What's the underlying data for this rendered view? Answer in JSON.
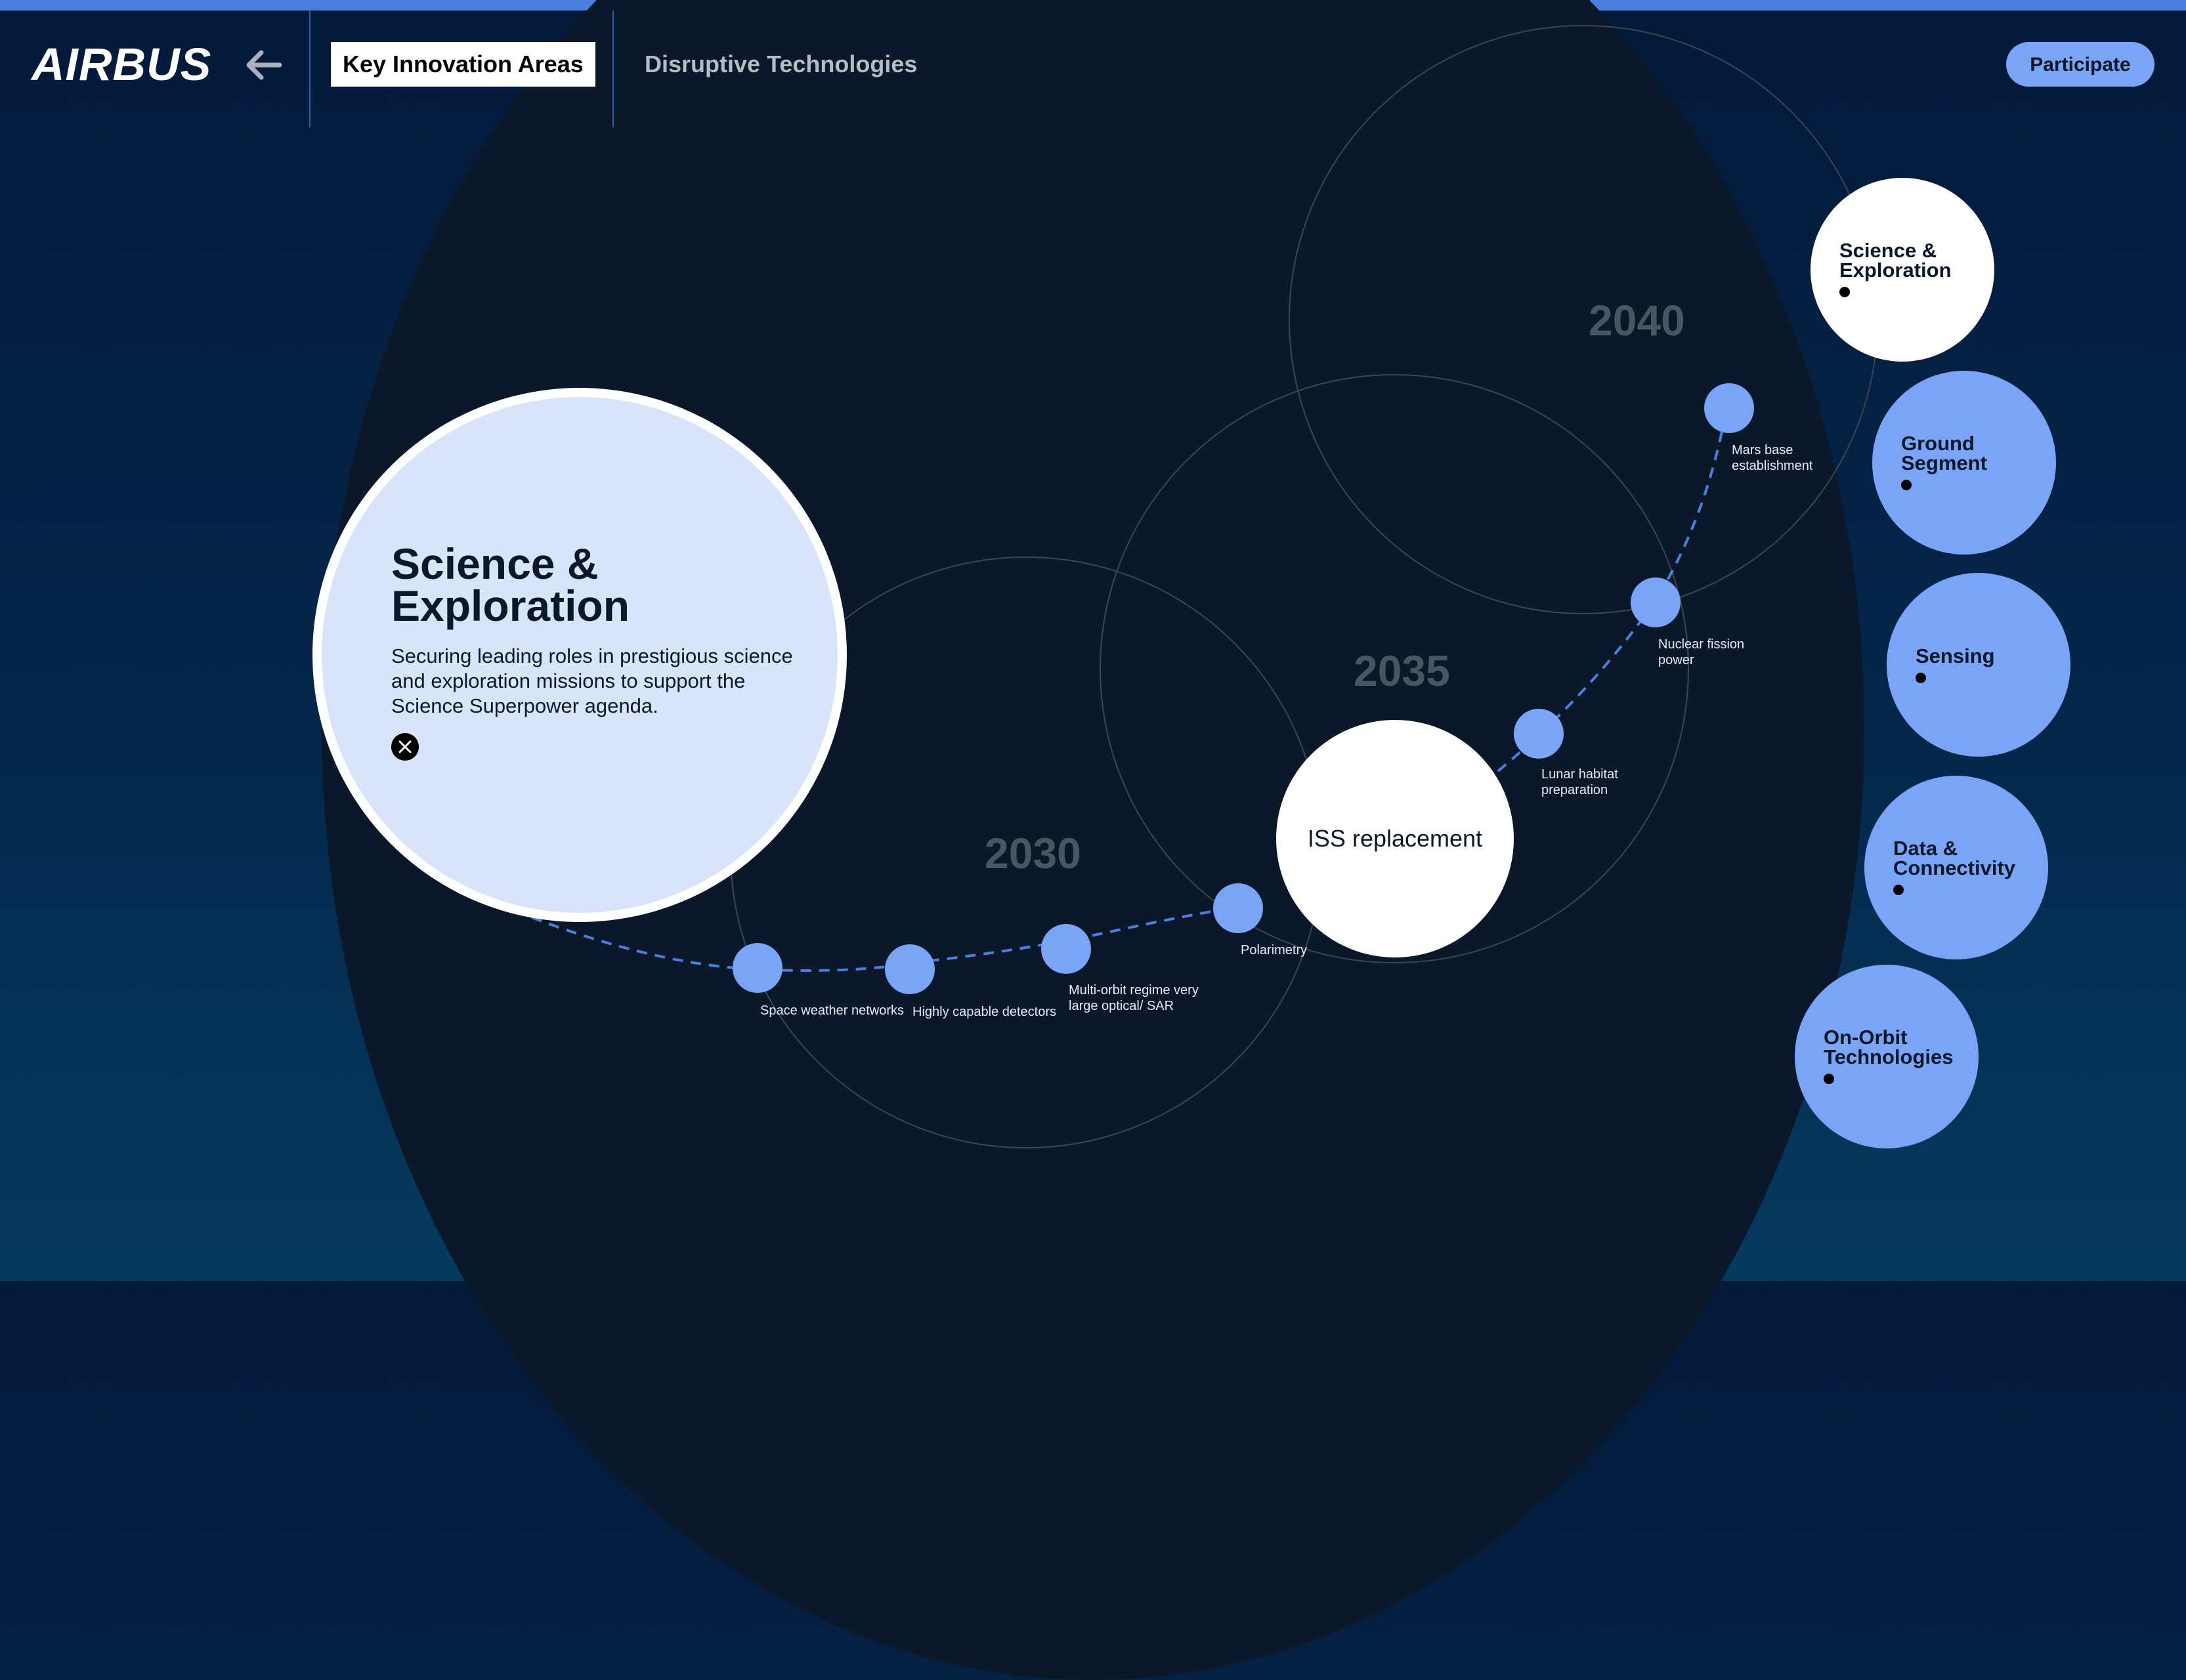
{
  "header": {
    "logo": "AIRBUS",
    "tabs": [
      {
        "label": "Key Innovation Areas"
      },
      {
        "label": "Disruptive Technologies"
      }
    ],
    "participate_label": "Participate"
  },
  "timeline": {
    "years": [
      "2030",
      "2035",
      "2040"
    ],
    "milestones": [
      {
        "label": "Space weather networks"
      },
      {
        "label": "Highly capable detectors"
      },
      {
        "label": "Multi-orbit regime very large optical/ SAR"
      },
      {
        "label": "Polarimetry"
      },
      {
        "label": "Lunar habitat preparation"
      },
      {
        "label": "Nuclear fission power"
      },
      {
        "label": "Mars base establishment"
      }
    ],
    "featured": "ISS replacement"
  },
  "card": {
    "title": "Science & Exploration",
    "description": "Securing leading roles in prestigious science and exploration missions to support the Science Superpower agenda."
  },
  "nav": [
    {
      "label": "Science & Exploration"
    },
    {
      "label": "Ground Segment"
    },
    {
      "label": "Sensing"
    },
    {
      "label": "Data & Connectivity"
    },
    {
      "label": "On-Orbit Technologies"
    }
  ],
  "colors": {
    "accent": "#7aa4f5",
    "background": "#0b1829",
    "topbar": "#4a7fe0",
    "card": "#d9e4fb"
  }
}
